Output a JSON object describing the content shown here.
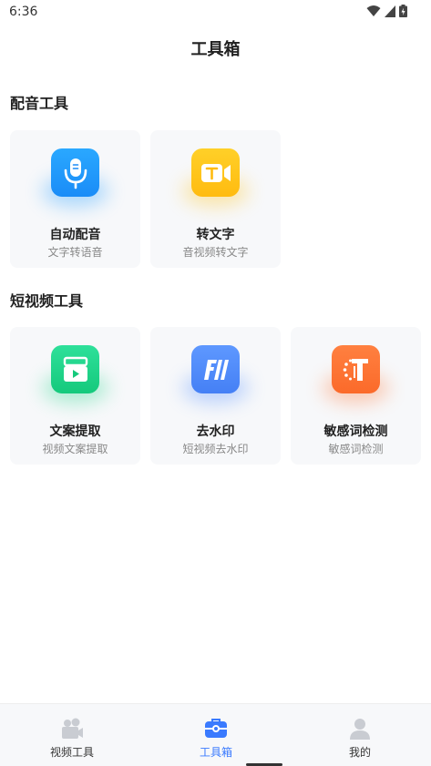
{
  "status": {
    "time": "6:36"
  },
  "header": {
    "title": "工具箱"
  },
  "sections": [
    {
      "title": "配音工具",
      "tools": [
        {
          "title": "自动配音",
          "subtitle": "文字转语音",
          "icon": "microphone-icon",
          "color": "#1e9bff"
        },
        {
          "title": "转文字",
          "subtitle": "音视频转文字",
          "icon": "text-video-icon",
          "color": "#ffc21a"
        }
      ]
    },
    {
      "title": "短视频工具",
      "tools": [
        {
          "title": "文案提取",
          "subtitle": "视频文案提取",
          "icon": "video-extract-icon",
          "color": "#22d58a"
        },
        {
          "title": "去水印",
          "subtitle": "短视频去水印",
          "icon": "watermark-remove-icon",
          "color": "#4f8cff"
        },
        {
          "title": "敏感词检测",
          "subtitle": "敏感词检测",
          "icon": "sensitive-word-icon",
          "color": "#ff7433"
        }
      ]
    }
  ],
  "tabbar": {
    "items": [
      {
        "label": "视频工具",
        "icon": "video-camera-icon",
        "active": false
      },
      {
        "label": "工具箱",
        "icon": "toolbox-icon",
        "active": true
      },
      {
        "label": "我的",
        "icon": "profile-icon",
        "active": false
      }
    ],
    "active_color": "#3a7afe",
    "inactive_icon_color": "#c9ccd2"
  }
}
